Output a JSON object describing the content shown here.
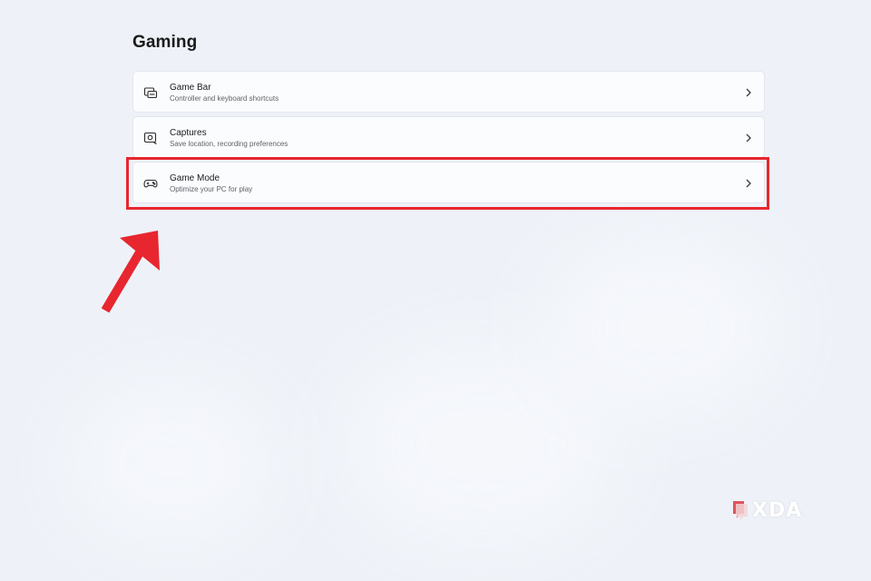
{
  "page": {
    "title": "Gaming"
  },
  "items": [
    {
      "title": "Game Bar",
      "subtitle": "Controller and keyboard shortcuts",
      "icon": "game-bar-icon"
    },
    {
      "title": "Captures",
      "subtitle": "Save location, recording preferences",
      "icon": "capture-icon"
    },
    {
      "title": "Game Mode",
      "subtitle": "Optimize your PC for play",
      "icon": "gamepad-icon"
    }
  ],
  "annotation": {
    "highlighted_item": "Game Mode",
    "highlight_color": "#e8262f"
  },
  "watermark": {
    "text": "XDA"
  }
}
